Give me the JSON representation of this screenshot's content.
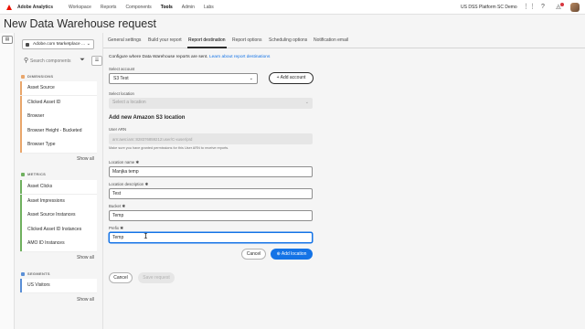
{
  "topnav": {
    "app_name": "Adobe Analytics",
    "links": [
      "Workspace",
      "Reports",
      "Components",
      "Tools",
      "Admin",
      "Labs"
    ],
    "active_link": "Tools",
    "org": "US DSS Platform SC Demo",
    "icons": [
      "apps-grid-icon",
      "help-icon",
      "notifications-bell-icon",
      "user-avatar"
    ],
    "brand_color": "#eb1000"
  },
  "page": {
    "title": "New Data Warehouse request"
  },
  "panel": {
    "report_suite": "Adobe.com Marketplace ...",
    "search_placeholder": "Search components",
    "show_all": "Show all",
    "dimensions": {
      "title": "DIMENSIONS",
      "items": [
        "Asset Source",
        "Clicked Asset ID",
        "Browser",
        "Browser Height - Bucketed",
        "Browser Type"
      ]
    },
    "metrics": {
      "title": "METRICS",
      "items": [
        "Asset Clicks",
        "Asset Impressions",
        "Asset Source Instances",
        "Clicked Asset ID Instances",
        "AMO ID Instances"
      ]
    },
    "segments": {
      "title": "SEGMENTS",
      "items": [
        "US Visitors"
      ]
    },
    "colors": {
      "dimension": "#e9a66b",
      "metric": "#6fb05f",
      "segment": "#5a8fd6"
    }
  },
  "tabs": [
    "General settings",
    "Build your report",
    "Report destination",
    "Report options",
    "Scheduling options",
    "Notification email"
  ],
  "active_tab": "Report destination",
  "destination": {
    "intro": "Configure where Data Warehouse reports are sent.",
    "learn_link": "Learn about report destinations",
    "select_account_label": "Select account",
    "account_value": "S3 Test",
    "add_account": "Add account",
    "select_location_label": "Select location",
    "location_placeholder": "Select a location",
    "new_location_heading": "Add new Amazon S3 location",
    "user_arn_label": "User ARN",
    "user_arn_value": "arn:aws:iam::828376859212:user/C-xuser/prd",
    "arn_hint": "Make sure you have granted permissions for this User ARN to receive reports.",
    "location_name_label": "Location name",
    "location_name_value": "Manjka temp",
    "location_desc_label": "Location description",
    "location_desc_value": "Test",
    "bucket_label": "Bucket",
    "bucket_value": "Temp",
    "prefix_label": "Prefix",
    "prefix_value": "Temp",
    "cancel": "Cancel",
    "add_location": "Add location"
  },
  "footer": {
    "cancel": "Cancel",
    "save_request": "Save request"
  }
}
